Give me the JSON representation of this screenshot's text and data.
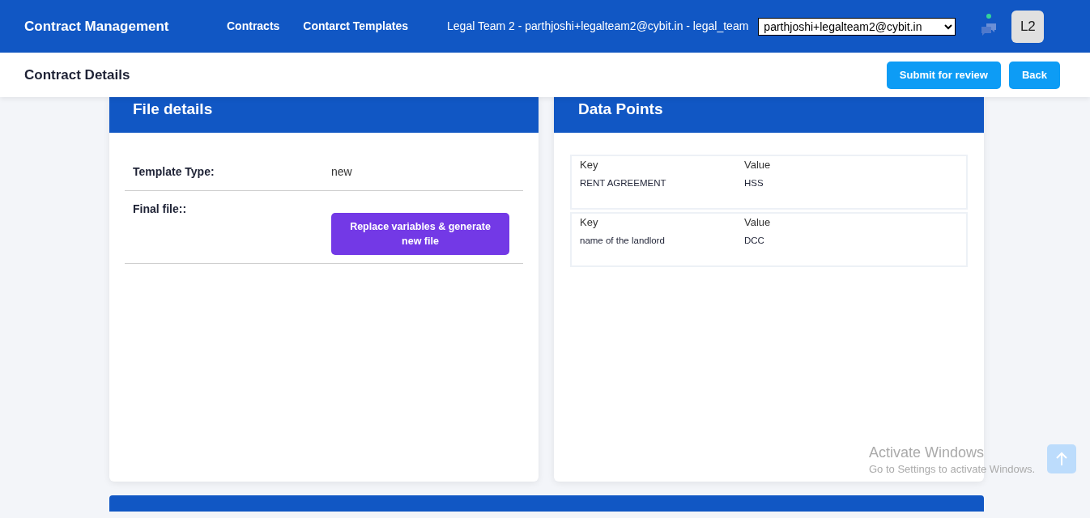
{
  "header": {
    "title": "Contract Management",
    "nav": [
      {
        "label": "Contracts"
      },
      {
        "label": "Contarct Templates"
      }
    ],
    "user_info": "Legal Team 2 - parthjoshi+legalteam2@cybit.in - legal_team",
    "account_select": {
      "value": "parthjoshi+legalteam2@cybit.in"
    },
    "chat_online": true,
    "avatar": "L2"
  },
  "subheader": {
    "title": "Contract Details",
    "buttons": [
      "Submit for review",
      "Back"
    ]
  },
  "file_details": {
    "title": "File details",
    "rows": [
      {
        "kind": "text",
        "label": "Template Type:",
        "value": "new"
      },
      {
        "kind": "button",
        "label": "Final file::",
        "value": "Replace variables & generate new file"
      }
    ]
  },
  "data_points": {
    "title": "Data Points",
    "items": [
      {
        "key_heading": "Key",
        "value_heading": "Value",
        "key": "RENT AGREEMENT",
        "value": "HSS"
      },
      {
        "key_heading": "Key",
        "value_heading": "Value",
        "key": "name of the landlord",
        "value": "DCC"
      }
    ]
  },
  "os_notice": {
    "title": "Activate Windows",
    "text": "Go to Settings to activate Windows."
  }
}
